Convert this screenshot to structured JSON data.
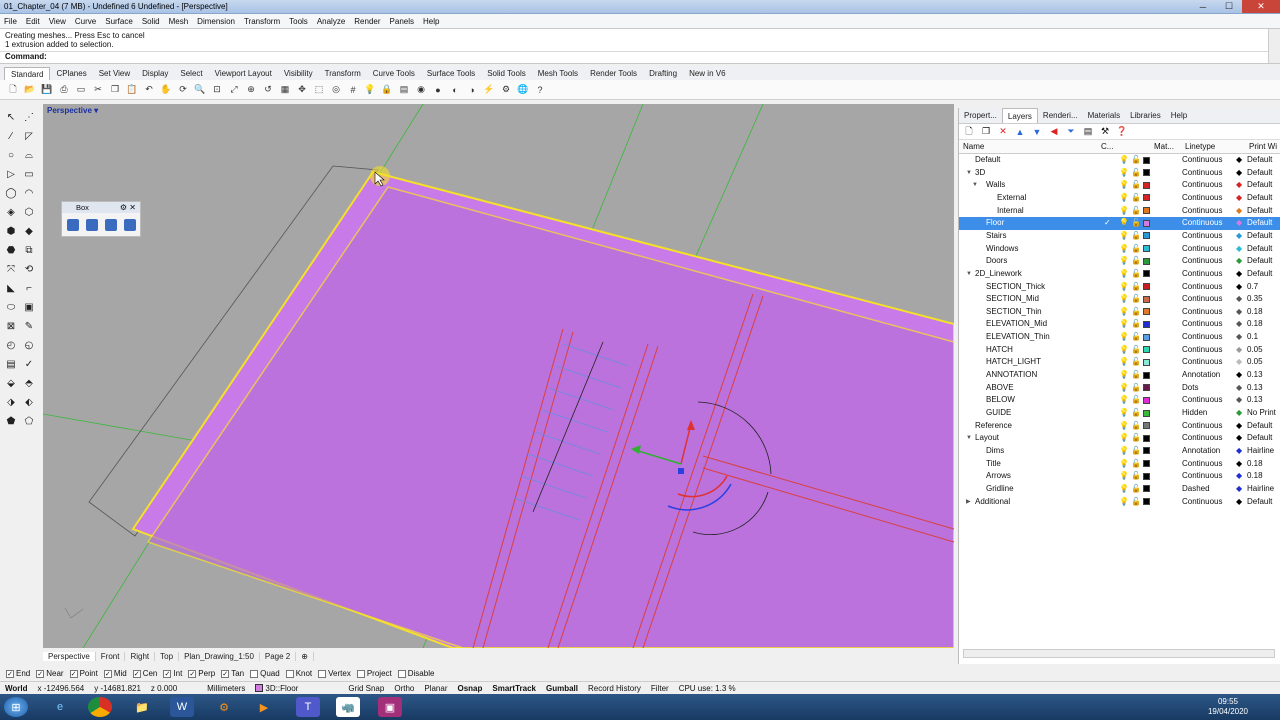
{
  "window": {
    "title": "01_Chapter_04 (7 MB) - Undefined 6 Undefined - [Perspective]"
  },
  "menu": [
    "File",
    "Edit",
    "View",
    "Curve",
    "Surface",
    "Solid",
    "Mesh",
    "Dimension",
    "Transform",
    "Tools",
    "Analyze",
    "Render",
    "Panels",
    "Help"
  ],
  "command": {
    "history": [
      "Creating meshes... Press Esc to cancel",
      "1 extrusion added to selection."
    ],
    "prompt": "Command:"
  },
  "toolbar_tabs": [
    "Standard",
    "CPlanes",
    "Set View",
    "Display",
    "Select",
    "Viewport Layout",
    "Visibility",
    "Transform",
    "Curve Tools",
    "Surface Tools",
    "Solid Tools",
    "Mesh Tools",
    "Render Tools",
    "Drafting",
    "New in V6"
  ],
  "toolbar_tabs_active": 0,
  "viewport": {
    "title": "Perspective"
  },
  "box_panel": {
    "title": "Box"
  },
  "viewport_tabs": [
    "Perspective",
    "Front",
    "Right",
    "Top",
    "Plan_Drawing_1:50",
    "Page 2"
  ],
  "viewport_tabs_active": 0,
  "panel_tabs": [
    "Propert...",
    "Layers",
    "Renderi...",
    "Materials",
    "Libraries",
    "Help"
  ],
  "panel_tabs_active": 1,
  "layer_columns": {
    "name": "Name",
    "current": "C...",
    "material": "Mat...",
    "linetype": "Linetype",
    "print_width": "Print Wi"
  },
  "layers": [
    {
      "name": "Default",
      "indent": 0,
      "expander": "",
      "color": "#000000",
      "linetype": "Continuous",
      "pcolor": "#000000",
      "print_width": "Default",
      "selected": false
    },
    {
      "name": "3D",
      "indent": 0,
      "expander": "▼",
      "color": "#000000",
      "linetype": "Continuous",
      "pcolor": "#000000",
      "print_width": "Default",
      "selected": false
    },
    {
      "name": "Walls",
      "indent": 1,
      "expander": "▼",
      "color": "#d62424",
      "linetype": "Continuous",
      "pcolor": "#d62424",
      "print_width": "Default",
      "selected": false
    },
    {
      "name": "External",
      "indent": 2,
      "expander": "",
      "color": "#d62424",
      "linetype": "Continuous",
      "pcolor": "#d62424",
      "print_width": "Default",
      "selected": false
    },
    {
      "name": "Internal",
      "indent": 2,
      "expander": "",
      "color": "#e0781c",
      "linetype": "Continuous",
      "pcolor": "#e0781c",
      "print_width": "Default",
      "selected": false
    },
    {
      "name": "Floor",
      "indent": 1,
      "expander": "",
      "color": "#d27be0",
      "linetype": "Continuous",
      "pcolor": "#d27be0",
      "print_width": "Default",
      "selected": true
    },
    {
      "name": "Stairs",
      "indent": 1,
      "expander": "",
      "color": "#2a9ad6",
      "linetype": "Continuous",
      "pcolor": "#2a9ad6",
      "print_width": "Default",
      "selected": false
    },
    {
      "name": "Windows",
      "indent": 1,
      "expander": "",
      "color": "#2abbd6",
      "linetype": "Continuous",
      "pcolor": "#2abbd6",
      "print_width": "Default",
      "selected": false
    },
    {
      "name": "Doors",
      "indent": 1,
      "expander": "",
      "color": "#2a9a3a",
      "linetype": "Continuous",
      "pcolor": "#2a9a3a",
      "print_width": "Default",
      "selected": false
    },
    {
      "name": "2D_Linework",
      "indent": 0,
      "expander": "▼",
      "color": "#000000",
      "linetype": "Continuous",
      "pcolor": "#000000",
      "print_width": "Default",
      "selected": false
    },
    {
      "name": "SECTION_Thick",
      "indent": 1,
      "expander": "",
      "color": "#c81e1e",
      "linetype": "Continuous",
      "pcolor": "#000000",
      "print_width": "0.7",
      "selected": false
    },
    {
      "name": "SECTION_Mid",
      "indent": 1,
      "expander": "",
      "color": "#c86a4a",
      "linetype": "Continuous",
      "pcolor": "#555555",
      "print_width": "0.35",
      "selected": false
    },
    {
      "name": "SECTION_Thin",
      "indent": 1,
      "expander": "",
      "color": "#e07a2a",
      "linetype": "Continuous",
      "pcolor": "#555555",
      "print_width": "0.18",
      "selected": false
    },
    {
      "name": "ELEVATION_Mid",
      "indent": 1,
      "expander": "",
      "color": "#1f2fcf",
      "linetype": "Continuous",
      "pcolor": "#555555",
      "print_width": "0.18",
      "selected": false
    },
    {
      "name": "ELEVATION_Thin",
      "indent": 1,
      "expander": "",
      "color": "#5aa0e8",
      "linetype": "Continuous",
      "pcolor": "#555555",
      "print_width": "0.1",
      "selected": false
    },
    {
      "name": "HATCH",
      "indent": 1,
      "expander": "",
      "color": "#30d6b0",
      "linetype": "Continuous",
      "pcolor": "#999999",
      "print_width": "0.05",
      "selected": false
    },
    {
      "name": "HATCH_LIGHT",
      "indent": 1,
      "expander": "",
      "color": "#8ae8d8",
      "linetype": "Continuous",
      "pcolor": "#bbbbbb",
      "print_width": "0.05",
      "selected": false
    },
    {
      "name": "ANNOTATION",
      "indent": 1,
      "expander": "",
      "color": "#000000",
      "linetype": "Annotation",
      "pcolor": "#000000",
      "print_width": "0.13",
      "selected": false
    },
    {
      "name": "ABOVE",
      "indent": 1,
      "expander": "",
      "color": "#6a1a4a",
      "linetype": "Dots",
      "pcolor": "#555555",
      "print_width": "0.13",
      "selected": false
    },
    {
      "name": "BELOW",
      "indent": 1,
      "expander": "",
      "color": "#e02ad6",
      "linetype": "Continuous",
      "pcolor": "#555555",
      "print_width": "0.13",
      "selected": false
    },
    {
      "name": "GUIDE",
      "indent": 1,
      "expander": "",
      "color": "#3ab83a",
      "linetype": "Hidden",
      "pcolor": "#2a9a3a",
      "print_width": "No Print",
      "selected": false
    },
    {
      "name": "Reference",
      "indent": 0,
      "expander": "",
      "color": "#777777",
      "linetype": "Continuous",
      "pcolor": "#000000",
      "print_width": "Default",
      "selected": false
    },
    {
      "name": "Layout",
      "indent": 0,
      "expander": "▼",
      "color": "#000000",
      "linetype": "Continuous",
      "pcolor": "#000000",
      "print_width": "Default",
      "selected": false
    },
    {
      "name": "Dims",
      "indent": 1,
      "expander": "",
      "color": "#000000",
      "linetype": "Annotation",
      "pcolor": "#1f2fcf",
      "print_width": "Hairline",
      "selected": false
    },
    {
      "name": "Title",
      "indent": 1,
      "expander": "",
      "color": "#000000",
      "linetype": "Continuous",
      "pcolor": "#000000",
      "print_width": "0.18",
      "selected": false
    },
    {
      "name": "Arrows",
      "indent": 1,
      "expander": "",
      "color": "#000000",
      "linetype": "Continuous",
      "pcolor": "#1f2fcf",
      "print_width": "0.18",
      "selected": false
    },
    {
      "name": "Gridline",
      "indent": 1,
      "expander": "",
      "color": "#000000",
      "linetype": "Dashed",
      "pcolor": "#1f2fcf",
      "print_width": "Hairline",
      "selected": false
    },
    {
      "name": "Additional",
      "indent": 0,
      "expander": "▶",
      "color": "#000000",
      "linetype": "Continuous",
      "pcolor": "#000000",
      "print_width": "Default",
      "selected": false
    }
  ],
  "osnaps": [
    {
      "label": "End",
      "checked": true
    },
    {
      "label": "Near",
      "checked": true
    },
    {
      "label": "Point",
      "checked": true
    },
    {
      "label": "Mid",
      "checked": true
    },
    {
      "label": "Cen",
      "checked": true
    },
    {
      "label": "Int",
      "checked": true
    },
    {
      "label": "Perp",
      "checked": true
    },
    {
      "label": "Tan",
      "checked": true
    },
    {
      "label": "Quad",
      "checked": false
    },
    {
      "label": "Knot",
      "checked": false
    },
    {
      "label": "Vertex",
      "checked": false
    },
    {
      "label": "Project",
      "checked": false
    },
    {
      "label": "Disable",
      "checked": false
    }
  ],
  "status": {
    "cplane": "World",
    "x": "x -12496.564",
    "y": "y -14681.821",
    "z": "z 0.000",
    "units": "Millimeters",
    "layer": "3D::Floor",
    "layer_color": "#d27be0",
    "grid_snap": "Grid Snap",
    "ortho": "Ortho",
    "planar": "Planar",
    "osnap": "Osnap",
    "smarttrack": "SmartTrack",
    "gumball": "Gumball",
    "record_history": "Record History",
    "filter": "Filter",
    "cpu": "CPU use: 1.3 %"
  },
  "clock": {
    "time": "09:55",
    "date": "19/04/2020"
  },
  "colors": {
    "floor": "#c77ae8",
    "selection": "#f5e02a",
    "wall_edge": "#d84040",
    "guide": "#3ab83a"
  }
}
